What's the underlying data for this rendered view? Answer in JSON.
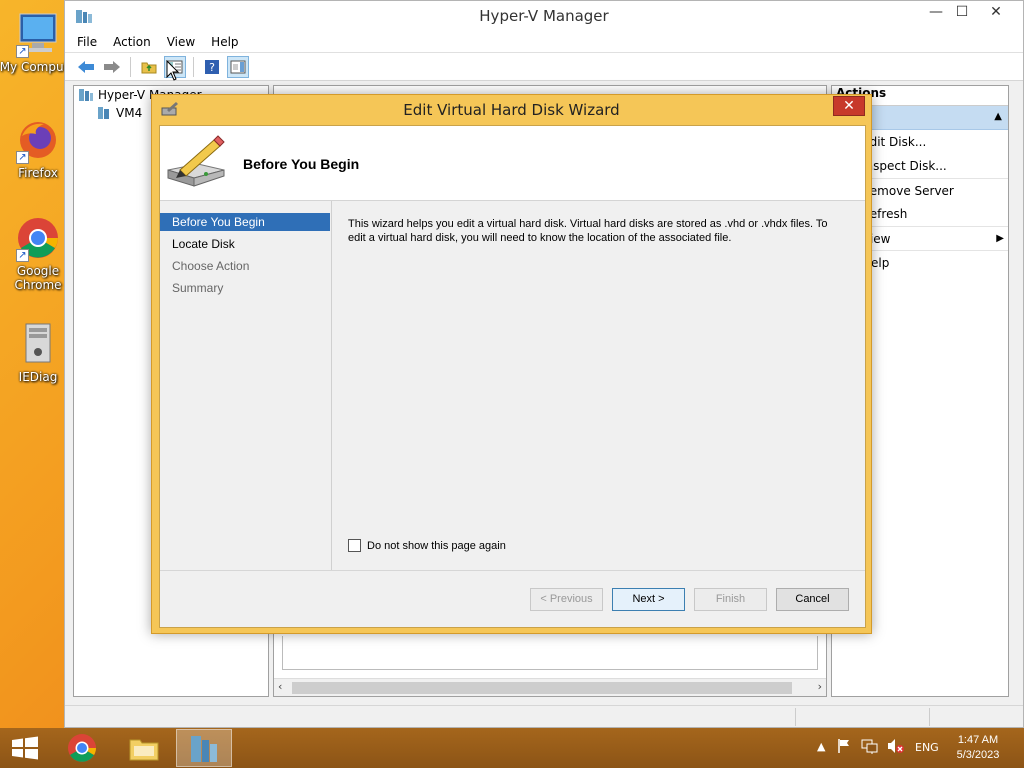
{
  "desktop": {
    "icons": [
      {
        "label": "My Comput"
      },
      {
        "label": "Firefox"
      },
      {
        "label": "Google Chrome"
      },
      {
        "label": "IEDiag"
      }
    ]
  },
  "window": {
    "title": "Hyper-V Manager",
    "menu": [
      "File",
      "Action",
      "View",
      "Help"
    ],
    "tree": {
      "root": "Hyper-V Manager",
      "child": "VM4"
    },
    "actions": {
      "header": "Actions",
      "items": [
        "Edit Disk...",
        "Inspect Disk...",
        "Remove Server",
        "Refresh",
        "View",
        "Help"
      ]
    }
  },
  "wizard": {
    "title": "Edit Virtual Hard Disk Wizard",
    "close": "✕",
    "heading": "Before You Begin",
    "steps": [
      "Before You Begin",
      "Locate Disk",
      "Choose Action",
      "Summary"
    ],
    "description": "This wizard helps you edit a virtual hard disk. Virtual hard disks are stored as .vhd or .vhdx files. To edit a virtual hard disk, you will need to know the location of the associated file.",
    "checkbox_label": "Do not show this page again",
    "buttons": {
      "previous": "< Previous",
      "next": "Next >",
      "finish": "Finish",
      "cancel": "Cancel"
    }
  },
  "taskbar": {
    "language": "ENG",
    "time": "1:47 AM",
    "date": "5/3/2023"
  },
  "colors": {
    "accent": "#2f6fb7",
    "dialog_frame": "#f5c657",
    "taskbar": "#8c5416"
  }
}
